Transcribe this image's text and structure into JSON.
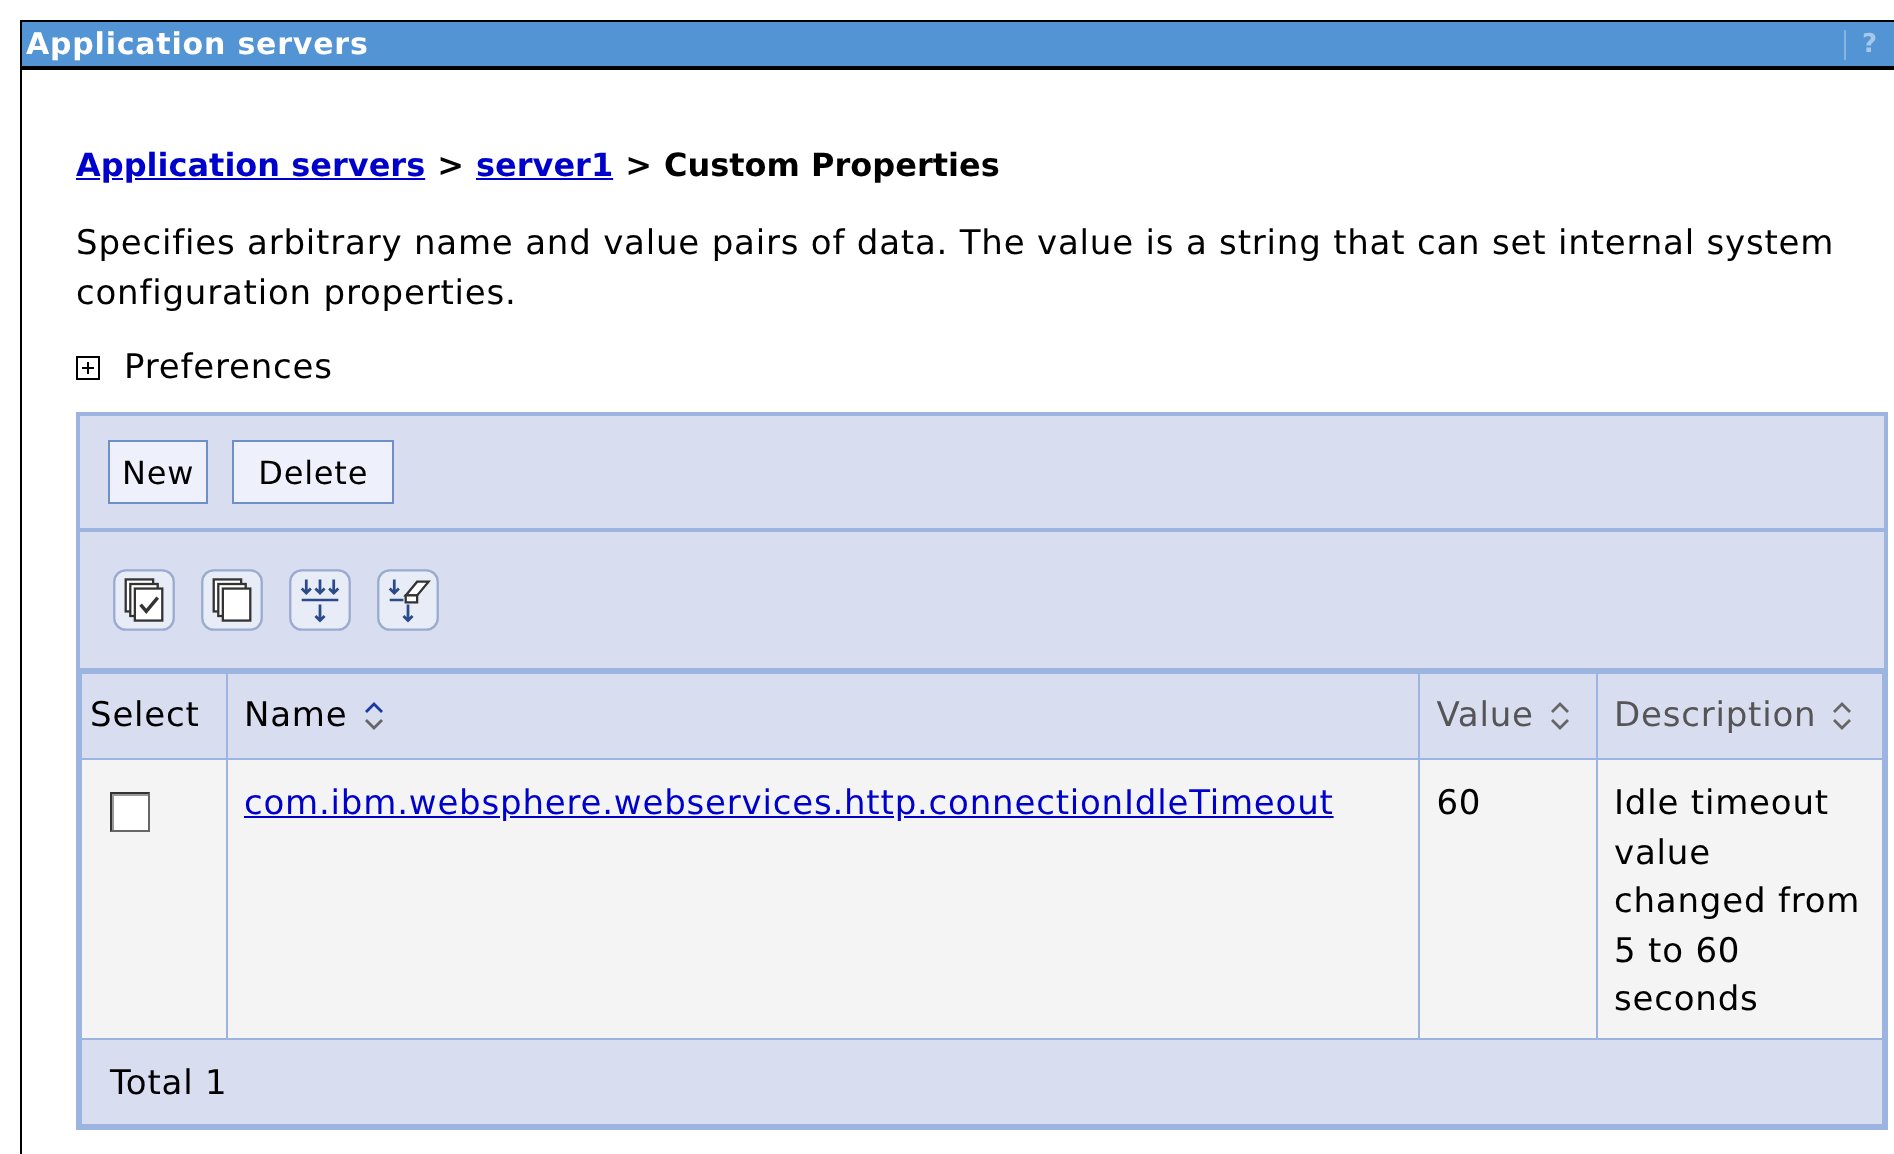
{
  "window": {
    "title": "Application servers",
    "help": "?"
  },
  "breadcrumb": [
    {
      "label": "Application servers",
      "link": true
    },
    {
      "label": "server1",
      "link": true
    },
    {
      "label": "Custom Properties",
      "link": false
    }
  ],
  "separator": ">",
  "description": "Specifies arbitrary name and value pairs of data. The value is a string that can set internal system configuration properties.",
  "preferences": {
    "label": "Preferences",
    "expanded": false
  },
  "buttons": [
    "New",
    "Delete"
  ],
  "toolbar_icons": [
    {
      "kind": "select-all"
    },
    {
      "kind": "deselect-all"
    },
    {
      "kind": "filter"
    },
    {
      "kind": "clear-filter"
    }
  ],
  "table": {
    "columns": [
      {
        "label": "Select",
        "sortable": false
      },
      {
        "label": "Name",
        "sortable": true,
        "sorted": true
      },
      {
        "label": "Value",
        "sortable": true,
        "sorted": false
      },
      {
        "label": "Description",
        "sortable": true,
        "sorted": false
      }
    ],
    "rows": [
      {
        "checked": false,
        "name": "com.ibm.websphere.webservices.http.connectionIdleTimeout",
        "value": "60",
        "description": "Idle timeout value changed from 5 to 60 seconds"
      }
    ],
    "total": "Total 1"
  }
}
